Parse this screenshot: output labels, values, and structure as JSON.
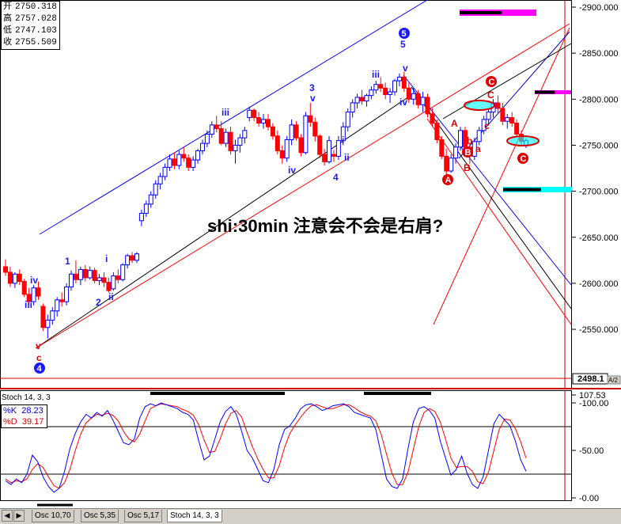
{
  "ohlc": {
    "open_label": "开",
    "open": "2750.318",
    "high_label": "高",
    "high": "2757.028",
    "low_label": "低",
    "low": "2747.103",
    "close_label": "收",
    "close": "2755.509"
  },
  "note": "shi:30min 注意会不会是右肩?",
  "price_axis": {
    "ticks": [
      "2900.000",
      "2850.000",
      "2800.000",
      "2750.000",
      "2700.000",
      "2650.000",
      "2600.000",
      "2550.000"
    ],
    "tick_values": [
      2900,
      2850,
      2800,
      2750,
      2700,
      2650,
      2600,
      2550
    ],
    "last_price_label": "2498.1",
    "small_tag": "A/2"
  },
  "oscillator": {
    "title": "Stoch 14, 3, 3",
    "k_label": "%K",
    "k_value": "28.23",
    "d_label": "%D",
    "d_value": "39.17",
    "ticks": [
      "107.53",
      "100.00",
      "50.00",
      "0.00"
    ],
    "tick_values": [
      107.53,
      100,
      50,
      0
    ]
  },
  "tabs": [
    "Osc 10,70",
    "Osc 5,35",
    "Osc 5,17",
    "Stoch 14, 3, 3"
  ],
  "wave_labels": {
    "blue": [
      "iii",
      "iv",
      "1",
      "2",
      "i",
      "ii",
      "iii",
      "3",
      "v",
      "iv",
      "4",
      "i",
      "ii",
      "iii",
      "v",
      "5",
      "iv"
    ],
    "red": [
      "v",
      "c",
      "A",
      "B",
      "C",
      "a",
      "b",
      "c"
    ],
    "circled": [
      "4",
      "5",
      "A",
      "B",
      "C"
    ]
  },
  "colors": {
    "up": "#0000ff",
    "down": "#ff0000",
    "stoch_k": "#0000ff",
    "stoch_d": "#ff0000",
    "highlight": "#00ffff",
    "magenta": "#ff00ff"
  },
  "chart_data": {
    "type": "candlestick",
    "price_range": [
      2490,
      2905
    ],
    "bars": [
      {
        "o": 2618,
        "h": 2626,
        "l": 2608,
        "c": 2612
      },
      {
        "o": 2612,
        "h": 2618,
        "l": 2596,
        "c": 2600
      },
      {
        "o": 2600,
        "h": 2612,
        "l": 2595,
        "c": 2610
      },
      {
        "o": 2610,
        "h": 2615,
        "l": 2598,
        "c": 2602
      },
      {
        "o": 2602,
        "h": 2605,
        "l": 2585,
        "c": 2588
      },
      {
        "o": 2588,
        "h": 2595,
        "l": 2578,
        "c": 2580
      },
      {
        "o": 2580,
        "h": 2598,
        "l": 2576,
        "c": 2595
      },
      {
        "o": 2595,
        "h": 2602,
        "l": 2582,
        "c": 2586
      },
      {
        "o": 2575,
        "h": 2578,
        "l": 2548,
        "c": 2552
      },
      {
        "o": 2552,
        "h": 2566,
        "l": 2540,
        "c": 2560
      },
      {
        "o": 2560,
        "h": 2574,
        "l": 2555,
        "c": 2570
      },
      {
        "o": 2570,
        "h": 2585,
        "l": 2564,
        "c": 2582
      },
      {
        "o": 2582,
        "h": 2590,
        "l": 2575,
        "c": 2580
      },
      {
        "o": 2580,
        "h": 2600,
        "l": 2576,
        "c": 2596
      },
      {
        "o": 2596,
        "h": 2614,
        "l": 2592,
        "c": 2610
      },
      {
        "o": 2610,
        "h": 2625,
        "l": 2600,
        "c": 2604
      },
      {
        "o": 2604,
        "h": 2618,
        "l": 2598,
        "c": 2615
      },
      {
        "o": 2615,
        "h": 2620,
        "l": 2602,
        "c": 2606
      },
      {
        "o": 2606,
        "h": 2618,
        "l": 2604,
        "c": 2614
      },
      {
        "o": 2614,
        "h": 2617,
        "l": 2600,
        "c": 2603
      },
      {
        "o": 2603,
        "h": 2610,
        "l": 2598,
        "c": 2606
      },
      {
        "o": 2606,
        "h": 2612,
        "l": 2596,
        "c": 2601
      },
      {
        "o": 2601,
        "h": 2606,
        "l": 2590,
        "c": 2592
      },
      {
        "o": 2594,
        "h": 2612,
        "l": 2592,
        "c": 2608
      },
      {
        "o": 2608,
        "h": 2615,
        "l": 2600,
        "c": 2604
      },
      {
        "o": 2604,
        "h": 2622,
        "l": 2602,
        "c": 2620
      },
      {
        "o": 2620,
        "h": 2632,
        "l": 2616,
        "c": 2630
      },
      {
        "o": 2630,
        "h": 2634,
        "l": 2622,
        "c": 2625
      },
      {
        "o": 2625,
        "h": 2634,
        "l": 2622,
        "c": 2632
      },
      {
        "o": 2668,
        "h": 2680,
        "l": 2662,
        "c": 2676
      },
      {
        "o": 2676,
        "h": 2690,
        "l": 2672,
        "c": 2686
      },
      {
        "o": 2686,
        "h": 2700,
        "l": 2682,
        "c": 2696
      },
      {
        "o": 2696,
        "h": 2712,
        "l": 2692,
        "c": 2708
      },
      {
        "o": 2708,
        "h": 2720,
        "l": 2702,
        "c": 2716
      },
      {
        "o": 2716,
        "h": 2730,
        "l": 2712,
        "c": 2726
      },
      {
        "o": 2726,
        "h": 2740,
        "l": 2722,
        "c": 2735
      },
      {
        "o": 2735,
        "h": 2742,
        "l": 2724,
        "c": 2728
      },
      {
        "o": 2728,
        "h": 2744,
        "l": 2724,
        "c": 2740
      },
      {
        "o": 2740,
        "h": 2748,
        "l": 2732,
        "c": 2736
      },
      {
        "o": 2736,
        "h": 2740,
        "l": 2722,
        "c": 2726
      },
      {
        "o": 2726,
        "h": 2738,
        "l": 2722,
        "c": 2734
      },
      {
        "o": 2734,
        "h": 2746,
        "l": 2730,
        "c": 2744
      },
      {
        "o": 2744,
        "h": 2756,
        "l": 2740,
        "c": 2752
      },
      {
        "o": 2752,
        "h": 2766,
        "l": 2748,
        "c": 2762
      },
      {
        "o": 2762,
        "h": 2776,
        "l": 2758,
        "c": 2772
      },
      {
        "o": 2772,
        "h": 2782,
        "l": 2764,
        "c": 2768
      },
      {
        "o": 2768,
        "h": 2776,
        "l": 2750,
        "c": 2752
      },
      {
        "o": 2752,
        "h": 2768,
        "l": 2748,
        "c": 2764
      },
      {
        "o": 2764,
        "h": 2770,
        "l": 2740,
        "c": 2744
      },
      {
        "o": 2744,
        "h": 2756,
        "l": 2730,
        "c": 2750
      },
      {
        "o": 2750,
        "h": 2762,
        "l": 2742,
        "c": 2758
      },
      {
        "o": 2758,
        "h": 2770,
        "l": 2752,
        "c": 2766
      },
      {
        "o": 2780,
        "h": 2792,
        "l": 2776,
        "c": 2788
      },
      {
        "o": 2788,
        "h": 2790,
        "l": 2776,
        "c": 2780
      },
      {
        "o": 2780,
        "h": 2786,
        "l": 2770,
        "c": 2774
      },
      {
        "o": 2774,
        "h": 2784,
        "l": 2768,
        "c": 2778
      },
      {
        "o": 2778,
        "h": 2784,
        "l": 2766,
        "c": 2770
      },
      {
        "o": 2770,
        "h": 2774,
        "l": 2756,
        "c": 2760
      },
      {
        "o": 2760,
        "h": 2766,
        "l": 2740,
        "c": 2744
      },
      {
        "o": 2744,
        "h": 2750,
        "l": 2730,
        "c": 2736
      },
      {
        "o": 2736,
        "h": 2760,
        "l": 2732,
        "c": 2756
      },
      {
        "o": 2756,
        "h": 2778,
        "l": 2750,
        "c": 2772
      },
      {
        "o": 2772,
        "h": 2776,
        "l": 2755,
        "c": 2758
      },
      {
        "o": 2758,
        "h": 2762,
        "l": 2738,
        "c": 2742
      },
      {
        "o": 2742,
        "h": 2786,
        "l": 2740,
        "c": 2782
      },
      {
        "o": 2782,
        "h": 2796,
        "l": 2770,
        "c": 2775
      },
      {
        "o": 2775,
        "h": 2780,
        "l": 2754,
        "c": 2760
      },
      {
        "o": 2760,
        "h": 2762,
        "l": 2736,
        "c": 2740
      },
      {
        "o": 2740,
        "h": 2746,
        "l": 2728,
        "c": 2732
      },
      {
        "o": 2732,
        "h": 2760,
        "l": 2730,
        "c": 2755
      },
      {
        "o": 2740,
        "h": 2745,
        "l": 2732,
        "c": 2738
      },
      {
        "o": 2738,
        "h": 2760,
        "l": 2734,
        "c": 2755
      },
      {
        "o": 2755,
        "h": 2775,
        "l": 2750,
        "c": 2770
      },
      {
        "o": 2770,
        "h": 2790,
        "l": 2765,
        "c": 2786
      },
      {
        "o": 2786,
        "h": 2800,
        "l": 2780,
        "c": 2796
      },
      {
        "o": 2796,
        "h": 2806,
        "l": 2790,
        "c": 2802
      },
      {
        "o": 2802,
        "h": 2810,
        "l": 2794,
        "c": 2798
      },
      {
        "o": 2798,
        "h": 2806,
        "l": 2792,
        "c": 2804
      },
      {
        "o": 2804,
        "h": 2814,
        "l": 2800,
        "c": 2810
      },
      {
        "o": 2810,
        "h": 2820,
        "l": 2806,
        "c": 2816
      },
      {
        "o": 2816,
        "h": 2824,
        "l": 2808,
        "c": 2812
      },
      {
        "o": 2812,
        "h": 2818,
        "l": 2800,
        "c": 2805
      },
      {
        "o": 2805,
        "h": 2812,
        "l": 2796,
        "c": 2808
      },
      {
        "o": 2808,
        "h": 2822,
        "l": 2804,
        "c": 2820
      },
      {
        "o": 2820,
        "h": 2828,
        "l": 2814,
        "c": 2824
      },
      {
        "o": 2824,
        "h": 2830,
        "l": 2808,
        "c": 2812
      },
      {
        "o": 2812,
        "h": 2818,
        "l": 2796,
        "c": 2800
      },
      {
        "o": 2800,
        "h": 2812,
        "l": 2794,
        "c": 2806
      },
      {
        "o": 2806,
        "h": 2810,
        "l": 2790,
        "c": 2794
      },
      {
        "o": 2794,
        "h": 2808,
        "l": 2786,
        "c": 2802
      },
      {
        "o": 2802,
        "h": 2806,
        "l": 2780,
        "c": 2784
      },
      {
        "o": 2784,
        "h": 2790,
        "l": 2770,
        "c": 2774
      },
      {
        "o": 2774,
        "h": 2778,
        "l": 2752,
        "c": 2756
      },
      {
        "o": 2756,
        "h": 2760,
        "l": 2735,
        "c": 2738
      },
      {
        "o": 2738,
        "h": 2746,
        "l": 2716,
        "c": 2722
      },
      {
        "o": 2722,
        "h": 2740,
        "l": 2720,
        "c": 2736
      },
      {
        "o": 2736,
        "h": 2752,
        "l": 2730,
        "c": 2748
      },
      {
        "o": 2748,
        "h": 2770,
        "l": 2744,
        "c": 2766
      },
      {
        "o": 2766,
        "h": 2770,
        "l": 2744,
        "c": 2748
      },
      {
        "o": 2748,
        "h": 2752,
        "l": 2730,
        "c": 2738
      },
      {
        "o": 2738,
        "h": 2758,
        "l": 2734,
        "c": 2754
      },
      {
        "o": 2754,
        "h": 2770,
        "l": 2750,
        "c": 2766
      },
      {
        "o": 2766,
        "h": 2782,
        "l": 2762,
        "c": 2778
      },
      {
        "o": 2778,
        "h": 2790,
        "l": 2772,
        "c": 2786
      },
      {
        "o": 2786,
        "h": 2800,
        "l": 2780,
        "c": 2796
      },
      {
        "o": 2796,
        "h": 2804,
        "l": 2784,
        "c": 2790
      },
      {
        "o": 2790,
        "h": 2796,
        "l": 2772,
        "c": 2776
      },
      {
        "o": 2776,
        "h": 2784,
        "l": 2768,
        "c": 2780
      },
      {
        "o": 2780,
        "h": 2786,
        "l": 2770,
        "c": 2774
      },
      {
        "o": 2774,
        "h": 2778,
        "l": 2758,
        "c": 2762
      },
      {
        "o": 2762,
        "h": 2766,
        "l": 2750,
        "c": 2754
      },
      {
        "o": 2750,
        "h": 2757,
        "l": 2747,
        "c": 2755
      }
    ],
    "stochastic": {
      "k": [
        18,
        14,
        20,
        16,
        25,
        45,
        38,
        22,
        12,
        6,
        10,
        28,
        52,
        68,
        80,
        88,
        84,
        90,
        86,
        92,
        82,
        70,
        58,
        56,
        62,
        84,
        96,
        99,
        97,
        100,
        98,
        96,
        94,
        90,
        88,
        82,
        60,
        40,
        44,
        62,
        80,
        91,
        96,
        88,
        70,
        50,
        42,
        30,
        18,
        16,
        30,
        56,
        72,
        76,
        84,
        94,
        98,
        99,
        96,
        92,
        94,
        97,
        98,
        99,
        96,
        90,
        88,
        86,
        84,
        72,
        46,
        20,
        12,
        10,
        20,
        52,
        80,
        94,
        96,
        92,
        84,
        60,
        42,
        24,
        30,
        44,
        26,
        14,
        10,
        22,
        50,
        78,
        88,
        82,
        76,
        60,
        40,
        28
      ],
      "d": [
        20,
        16,
        18,
        17,
        20,
        30,
        36,
        32,
        22,
        13,
        10,
        16,
        30,
        50,
        67,
        79,
        84,
        88,
        87,
        89,
        87,
        81,
        70,
        62,
        59,
        67,
        81,
        94,
        97,
        99,
        98,
        97,
        96,
        93,
        91,
        87,
        77,
        61,
        48,
        49,
        62,
        78,
        89,
        92,
        85,
        69,
        54,
        41,
        30,
        21,
        21,
        34,
        53,
        68,
        77,
        85,
        92,
        97,
        98,
        96,
        94,
        94,
        96,
        98,
        98,
        95,
        91,
        88,
        86,
        81,
        67,
        46,
        26,
        14,
        14,
        27,
        51,
        75,
        90,
        94,
        91,
        80,
        62,
        42,
        32,
        33,
        33,
        28,
        17,
        15,
        27,
        50,
        72,
        83,
        82,
        73,
        59,
        42
      ]
    }
  }
}
